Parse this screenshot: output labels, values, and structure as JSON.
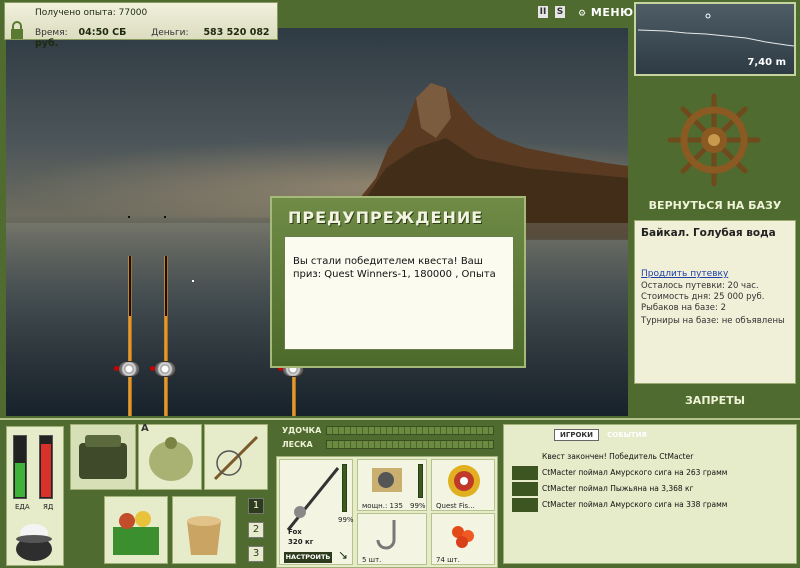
{
  "hud": {
    "experience_label": "Получено опыта:",
    "experience_value": "77000",
    "time_label": "Время:",
    "time_value": "04:50 СБ",
    "money_label": "Деньги:",
    "money_value": "583 520 082 руб.",
    "pause_label": "II",
    "sound_label": "S",
    "menu_label": "МЕНЮ"
  },
  "depth": {
    "value": "7,40 m"
  },
  "right_panel": {
    "return_label": "ВЕРНУТЬСЯ НА БАЗУ",
    "base_title": "Байкал. Голубая вода",
    "extend_link": "Продлить путевку",
    "lines": [
      "Осталось путевки: 20 час.",
      "Стоимость дня: 25 000 руб.",
      "Рыбаков на базе: 2",
      "Турниры на базе: не объявлены"
    ],
    "bans_label": "ЗАПРЕТЫ"
  },
  "dialog": {
    "title": "ПРЕДУПРЕЖДЕНИЕ",
    "message": "Вы стали победителем квеста! Ваш приз: Quest Winners-1, 180000 , Опыта"
  },
  "gauges": {
    "food_label": "ЕДА",
    "food_level": 0.55,
    "poison_label": "ЯД",
    "poison_level": 0.85,
    "food_color": "#3fb23a",
    "poison_color": "#d8312b"
  },
  "inventory": {
    "pages": [
      "1",
      "2",
      "3"
    ],
    "active_page": "1",
    "marker": "A"
  },
  "tackle": {
    "rod_label": "УДОЧКА",
    "line_label": "ЛЕСКА",
    "rod_name": "Fox",
    "rod_weight": "320 кг",
    "rod_percent": "99%",
    "reel_power": "мощн.: 135",
    "reel_percent": "99%",
    "line_name": "Quest Fis...",
    "hook_count": "5 шт.",
    "bait_count": "74 шт.",
    "adjust_label": "НАСТРОИТЬ"
  },
  "events": {
    "tab_players": "ИГРОКИ",
    "tab_events": "СОБЫТИЯ",
    "items": [
      "Квест закончен! Победитель CtMacter",
      "CtMacter поймал Амурского сига на 263 грамм",
      "CtMacter поймал Пыжьяна на 3,368 кг",
      "CtMacter поймал Амурского сига на 338 грамм"
    ]
  }
}
